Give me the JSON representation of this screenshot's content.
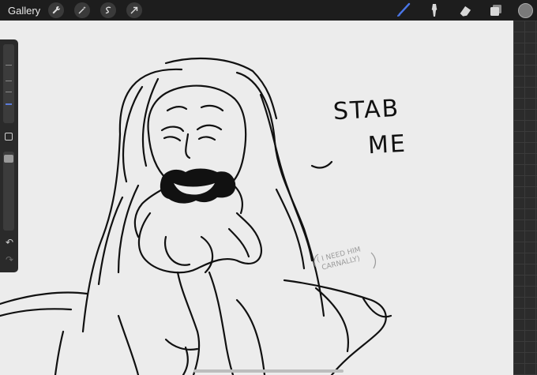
{
  "topbar": {
    "gallery_label": "Gallery",
    "left_icons": [
      "wrench-icon",
      "magic-wand-icon",
      "selection-icon",
      "transform-arrow-icon"
    ],
    "right_tools": [
      "brush-icon",
      "smudge-icon",
      "eraser-icon",
      "layers-icon"
    ],
    "accent": "#4a76e8",
    "current_color": "#7a7a7a"
  },
  "canvas": {
    "speech_line1": "STAB",
    "speech_line2": "ME",
    "note_line1": "( I NEED HIM",
    "note_line2": "CARNALLY)"
  },
  "sidebar": {
    "brush_size_level": 0.3,
    "icons": [
      "modify-square-icon",
      "undo-icon",
      "redo-icon"
    ]
  }
}
